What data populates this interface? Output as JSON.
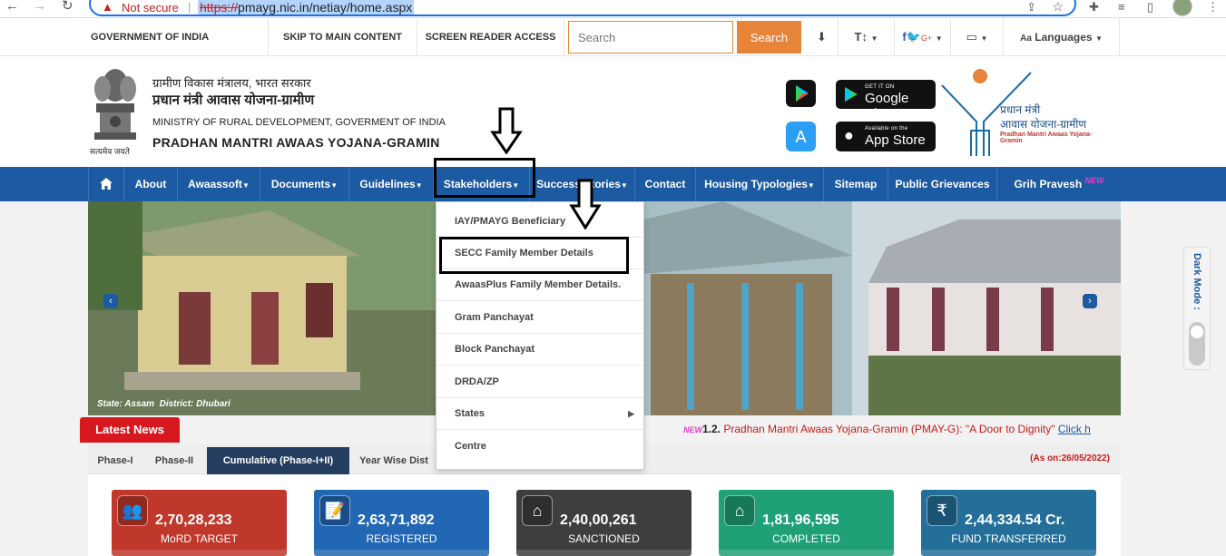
{
  "browser": {
    "not_secure": "Not secure",
    "url_scheme": "https://",
    "url_rest": "pmayg.nic.in/netiay/home.aspx"
  },
  "topbar": {
    "gov": "GOVERNMENT OF INDIA",
    "skip": "SKIP TO MAIN CONTENT",
    "screen_reader": "SCREEN READER ACCESS",
    "search_placeholder": "Search",
    "search_button": "Search",
    "text_size": "T↕",
    "languages": "Languages"
  },
  "header": {
    "hindi_ministry": "ग्रामीण विकास मंत्रालय, भारत सरकार",
    "hindi_scheme": "प्रधान मंत्री आवास योजना-ग्रामीण",
    "en_ministry": "MINISTRY OF RURAL DEVELOPMENT, GOVERMENT OF INDIA",
    "en_scheme": "PRADHAN MANTRI AWAAS YOJANA-GRAMIN",
    "motto": "सत्यमेव जयते",
    "google_play_small": "GET IT ON",
    "google_play": "Google Play",
    "app_store_small": "Available on the",
    "app_store": "App Store",
    "logo_line1": "प्रधान मंत्री",
    "logo_line2": "आवास योजना-ग्रामीण",
    "logo_line3": "Pradhan Mantri Awaas Yojana-Gramin"
  },
  "nav": {
    "about": "About",
    "awaassoft": "Awaassoft",
    "documents": "Documents",
    "guidelines": "Guidelines",
    "stakeholders": "Stakeholders",
    "success_stories": "Success Stories",
    "contact": "Contact",
    "housing": "Housing Typologies",
    "sitemap": "Sitemap",
    "grievances": "Public Grievances",
    "grih_pravesh": "Grih Pravesh",
    "new_badge": "NEW"
  },
  "dropdown": {
    "items": [
      "IAY/PMAYG Beneficiary",
      "SECC Family Member Details",
      "AwaasPlus Family Member Details.",
      "Gram Panchayat",
      "Block Panchayat",
      "DRDA/ZP",
      "States",
      "Centre"
    ]
  },
  "banner": {
    "state_label": "State:",
    "state": "Assam",
    "district_label": "District:",
    "district": "Dhubari"
  },
  "darkmode": {
    "label": "Dark Mode :"
  },
  "news": {
    "title": "Latest News",
    "new_badge": "NEW",
    "number": "1.2.",
    "text": " Pradhan Mantri Awaas Yojana-Gramin (PMAY-G): \"A Door to Dignity\" ",
    "click": "Click h"
  },
  "tabs": {
    "items": [
      "Phase-I",
      "Phase-II",
      "Cumulative (Phase-I+II)",
      "Year Wise Dist"
    ],
    "active": "Cumulative (Phase-I+II)",
    "as_on": "(As on:26/05/2022)"
  },
  "stats": [
    {
      "value": "2,70,28,233",
      "label": "MoRD TARGET",
      "color": "#c0382b"
    },
    {
      "value": "2,63,71,892",
      "label": "REGISTERED",
      "color": "#2167b3"
    },
    {
      "value": "2,40,00,261",
      "label": "SANCTIONED",
      "color": "#3e3e3e"
    },
    {
      "value": "1,81,96,595",
      "label": "COMPLETED",
      "color": "#1fa077"
    },
    {
      "value": "2,44,334.54 Cr.",
      "label": "FUND TRANSFERRED",
      "color": "#246f99"
    }
  ],
  "colors": {
    "nav": "#1c5aa1",
    "accent": "#e8833a",
    "news_red": "#d7181f"
  }
}
